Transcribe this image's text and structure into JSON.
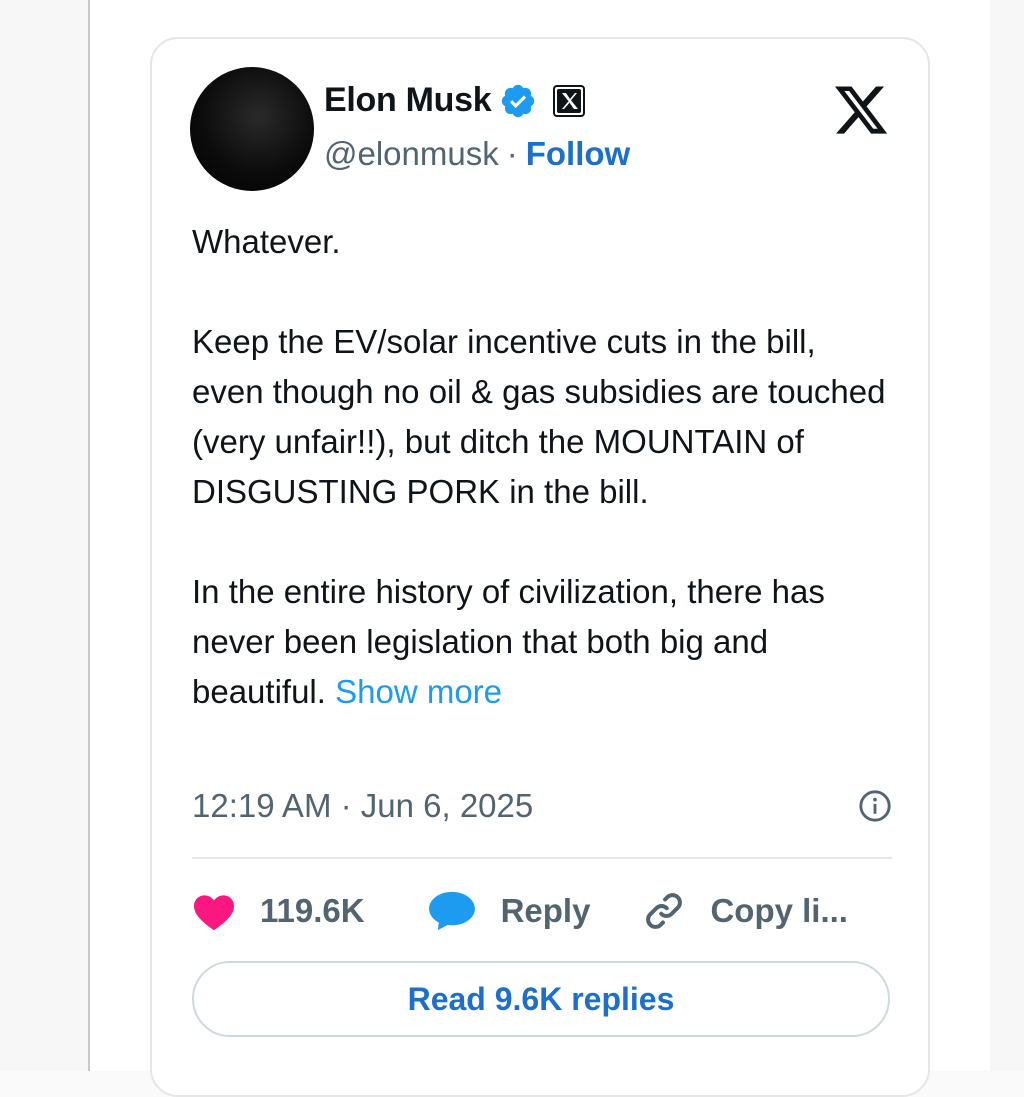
{
  "author": {
    "name": "Elon Musk",
    "handle": "@elonmusk",
    "separator": "·",
    "follow_label": "Follow"
  },
  "tweet": {
    "paragraph_1": "Whatever.",
    "paragraph_2": "Keep the EV/solar incentive cuts in the bill, even though no oil & gas subsidies are touched (very unfair!!), but ditch the MOUNTAIN of DISGUSTING PORK in the bill.",
    "paragraph_3": "In the entire history of civilization, there has never been legislation that both big and beautiful.",
    "show_more_label": "Show more",
    "timestamp": "12:19 AM · Jun 6, 2025"
  },
  "actions": {
    "like_count": "119.6K",
    "reply_label": "Reply",
    "copy_label": "Copy li..."
  },
  "read_replies_label": "Read 9.6K replies",
  "icons": {
    "verified": "verified-badge-icon",
    "affiliation": "x-affiliation-icon",
    "brand": "x-logo-icon",
    "info": "info-icon",
    "like": "heart-icon",
    "reply": "speech-bubble-icon",
    "copy": "link-icon"
  },
  "colors": {
    "accent_blue": "#1d9bf0",
    "follow_blue": "#1d6fc9",
    "like_pink": "#f91880",
    "text_primary": "#0f1419",
    "text_secondary": "#536471"
  }
}
